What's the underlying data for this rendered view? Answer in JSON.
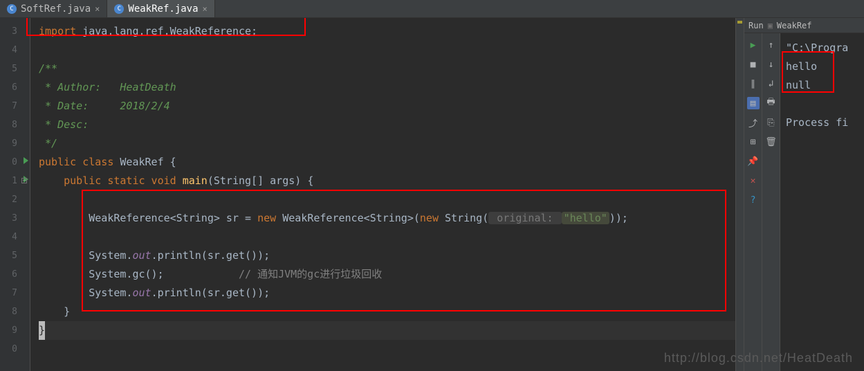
{
  "tabs": [
    {
      "icon_letter": "C",
      "label": "SoftRef.java",
      "active": false
    },
    {
      "icon_letter": "C",
      "label": "WeakRef.java",
      "active": true
    }
  ],
  "line_numbers": [
    "3",
    "4",
    "5",
    "6",
    "7",
    "8",
    "9",
    "0",
    "1",
    "2",
    "3",
    "4",
    "5",
    "6",
    "7",
    "8",
    "9",
    "0"
  ],
  "code": {
    "l3_import": "import",
    "l3_pkg": " java.lang.ref.WeakReference;",
    "l5_cmt": "/**",
    "l6_cmt": " * Author:   HeatDeath",
    "l7_cmt": " * Date:     2018/2/4",
    "l8_cmt": " * Desc:",
    "l9_cmt": " */",
    "l10_public": "public class",
    "l10_name": " WeakRef ",
    "l10_brace": "{",
    "l11_public": "    public static void",
    "l11_main": " main",
    "l11_args": "(String[] args) {",
    "l13_a": "        WeakReference<String> sr = ",
    "l13_new1": "new",
    "l13_b": " WeakReference<String>(",
    "l13_new2": "new",
    "l13_c": " String(",
    "l13_hint": " original: ",
    "l13_str": "\"hello\"",
    "l13_d": "));",
    "l15_a": "        System.",
    "l15_out": "out",
    "l15_b": ".println(sr.get());",
    "l16_a": "        System.",
    "l16_gc": "gc",
    "l16_b": "();",
    "l16_cmt": "            // 通知JVM的gc进行垃圾回收",
    "l17_a": "        System.",
    "l17_out": "out",
    "l17_b": ".println(sr.get());",
    "l18": "    }",
    "l19": "}"
  },
  "run": {
    "title_prefix": "Run",
    "title_config": "WeakRef",
    "line1": "\"C:\\Progra",
    "line2": "hello",
    "line3": "null",
    "line4": "Process fi"
  },
  "watermark": "http://blog.csdn.net/HeatDeath"
}
